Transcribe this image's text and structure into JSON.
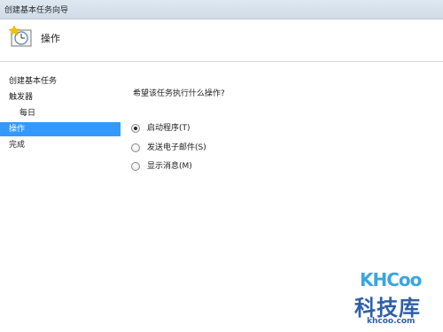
{
  "window": {
    "title": "创建基本任务向导"
  },
  "header": {
    "heading": "操作",
    "icon": "task-clock-icon"
  },
  "nav": {
    "items": [
      {
        "label": "创建基本任务",
        "indent": false,
        "selected": false
      },
      {
        "label": "触发器",
        "indent": false,
        "selected": false
      },
      {
        "label": "每日",
        "indent": true,
        "selected": false
      },
      {
        "label": "操作",
        "indent": false,
        "selected": true
      },
      {
        "label": "完成",
        "indent": false,
        "selected": false
      }
    ]
  },
  "main": {
    "question": "希望该任务执行什么操作?",
    "options": [
      {
        "label": "启动程序(T)",
        "checked": true
      },
      {
        "label": "发送电子邮件(S)",
        "checked": false
      },
      {
        "label": "显示消息(M)",
        "checked": false
      }
    ]
  },
  "watermark": {
    "logo": "KHCoo",
    "name": "科技库",
    "url": "khcoo.com"
  },
  "colors": {
    "selection": "#3399ff",
    "titlebar": "#cfdbe8"
  }
}
